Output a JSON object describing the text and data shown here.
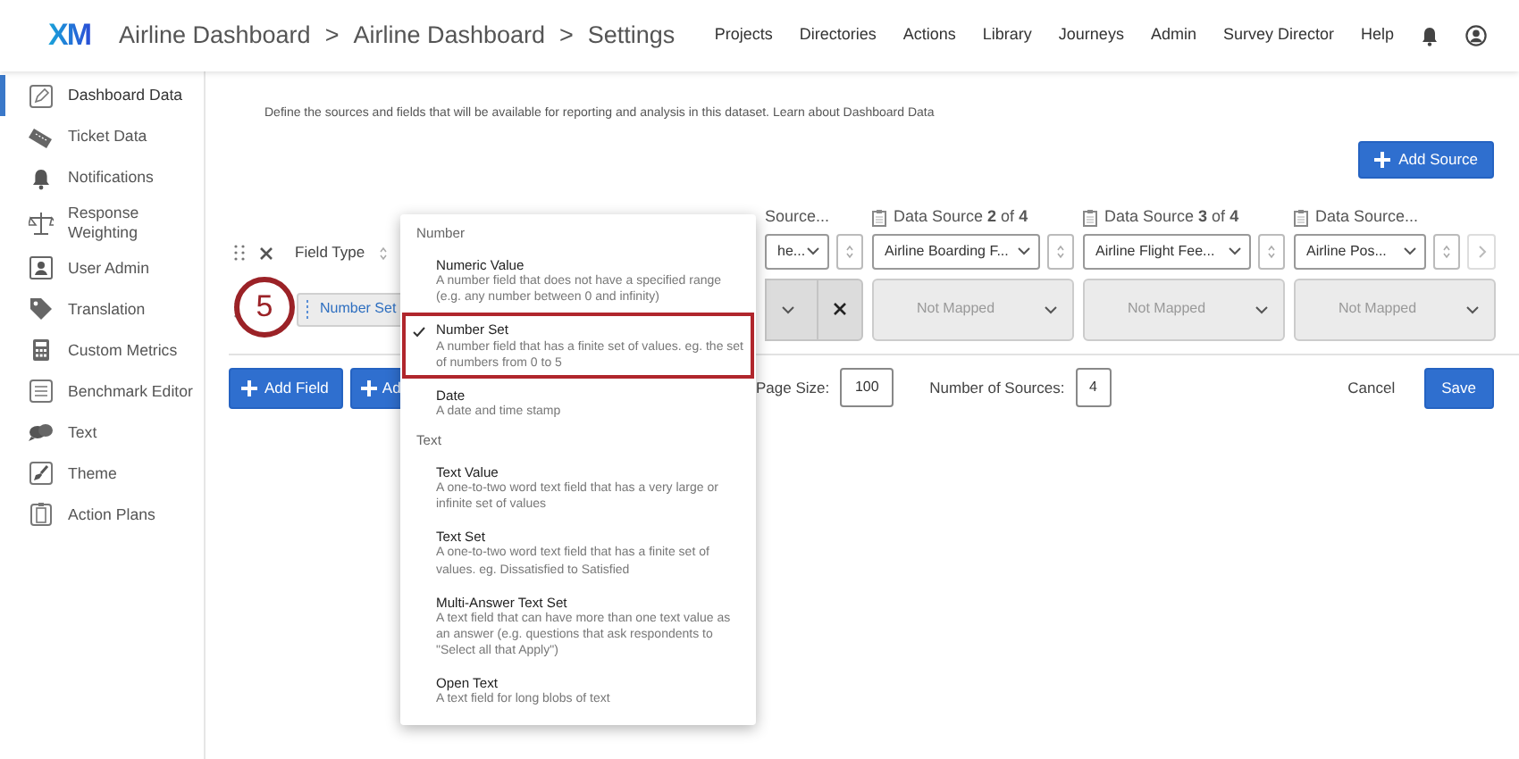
{
  "header": {
    "logo": "XM",
    "breadcrumb": [
      {
        "label": "Airline Dashboard"
      },
      {
        "separator": ">",
        "label": "Airline Dashboard"
      },
      {
        "separator": ">",
        "label": "Settings"
      }
    ],
    "nav": [
      "Projects",
      "Directories",
      "Actions",
      "Library",
      "Journeys",
      "Admin",
      "Survey Director",
      "Help"
    ]
  },
  "sidebar": {
    "items": [
      {
        "label": "Dashboard Data",
        "selected": true
      },
      {
        "label": "Ticket Data",
        "selected": false
      },
      {
        "label": "Notifications",
        "selected": false
      },
      {
        "label": "Response Weighting",
        "selected": false
      },
      {
        "label": "User Admin",
        "selected": false
      },
      {
        "label": "Translation",
        "selected": false
      },
      {
        "label": "Custom Metrics",
        "selected": false
      },
      {
        "label": "Benchmark Editor",
        "selected": false
      },
      {
        "label": "Text",
        "selected": false
      },
      {
        "label": "Theme",
        "selected": false
      },
      {
        "label": "Action Plans",
        "selected": false
      }
    ]
  },
  "description": {
    "text": "Define the sources and fields that will be available for reporting and analysis in this dataset.",
    "link": "Learn about Dashboard Data"
  },
  "add_source": "Add Source",
  "field_table": {
    "field_type_header": "Field Type",
    "sources": [
      {
        "title": "Source...",
        "selected_source": "he..."
      },
      {
        "title": "Data Source **2** of **4**",
        "selected_source": "Airline Boarding F..."
      },
      {
        "title": "Data Source **3** of **4**",
        "selected_source": "Airline Flight Fee..."
      },
      {
        "title": "Data Source...",
        "selected_source": "Airline Pos..."
      }
    ],
    "row": {
      "field_type": "Number Set",
      "mappings": [
        {
          "kind": "mapped"
        },
        {
          "kind": "unmapped",
          "value": "Not Mapped"
        },
        {
          "kind": "unmapped",
          "value": "Not Mapped"
        },
        {
          "kind": "unmapped",
          "value": "Not Mapped"
        }
      ]
    }
  },
  "step_marker": "5",
  "footer": {
    "add_field": "Add Field",
    "second_button": "Ad",
    "page_size_label": "Page Size:",
    "page_size": "100",
    "sources_label": "Number of Sources:",
    "sources": "4",
    "cancel": "Cancel",
    "save": "Save"
  },
  "menu": {
    "groups": [
      {
        "label": "Number",
        "options": [
          {
            "title": "Numeric Value",
            "description": "A number field that does not have a specified range (e.g. any number between 0 and infinity)",
            "selected": false
          },
          {
            "title": "Number Set",
            "description": "A number field that has a finite set of values. eg. the set of numbers from 0 to 5",
            "selected": true
          },
          {
            "title": "Date",
            "description": "A date and time stamp",
            "selected": false
          }
        ]
      },
      {
        "label": "Text",
        "options": [
          {
            "title": "Text Value",
            "description": "A one-to-two word text field that has a very large or infinite set of values",
            "selected": false
          },
          {
            "title": "Text Set",
            "description": "A one-to-two word text field that has a finite set of values. eg. Dissatisfied to Satisfied",
            "selected": false
          },
          {
            "title": "Multi-Answer Text Set",
            "description": "A text field that can have more than one text value as an answer (e.g. questions that ask respondents to \"Select all that Apply\")",
            "selected": false
          },
          {
            "title": "Open Text",
            "description": "A text field for long blobs of text",
            "selected": false
          }
        ]
      }
    ]
  }
}
